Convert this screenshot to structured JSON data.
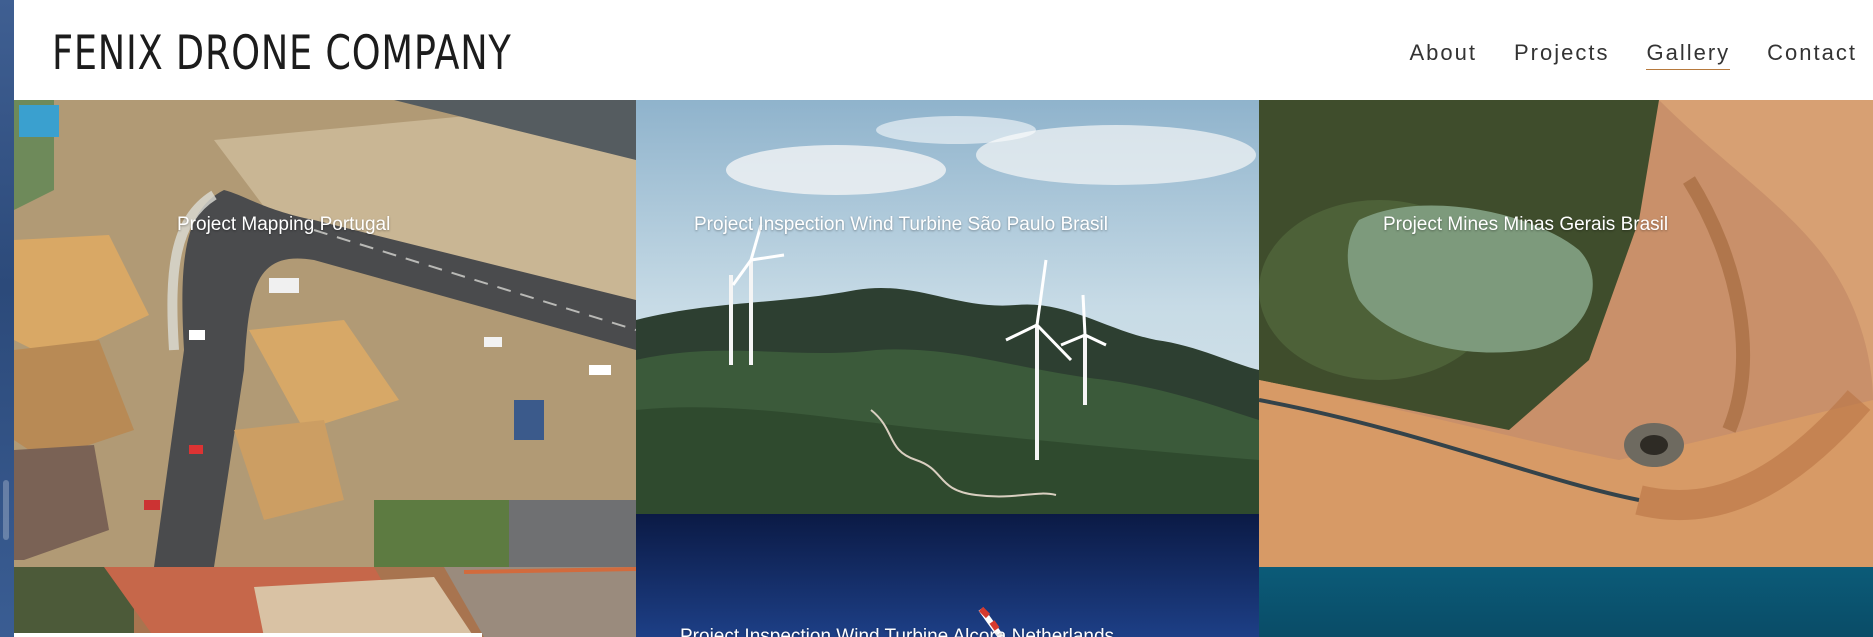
{
  "brand": {
    "name": "FENIX DRONE COMPANY"
  },
  "nav": {
    "items": [
      {
        "label": "About"
      },
      {
        "label": "Projects"
      },
      {
        "label": "Gallery",
        "active": true
      },
      {
        "label": "Contact"
      }
    ],
    "active_underline_color": "#b77a3e"
  },
  "gallery": {
    "tiles": [
      {
        "caption": "Project Mapping Portugal",
        "image": "aerial-suburban-construction-photo"
      },
      {
        "caption": "Project Inspection Wind Turbine São Paulo Brasil",
        "image": "wind-turbines-mountains-photo"
      },
      {
        "caption": "Project Mines Minas Gerais Brasil",
        "image": "aerial-mine-lake-photo"
      },
      {
        "caption": "Project Inspection Wind Turbine Alcora Netherlands",
        "image": "wind-turbine-night-sky-photo"
      },
      {
        "caption": "",
        "image": "aerial-red-earth-quarry-photo"
      },
      {
        "caption": "",
        "image": "teal-water-photo"
      }
    ]
  }
}
